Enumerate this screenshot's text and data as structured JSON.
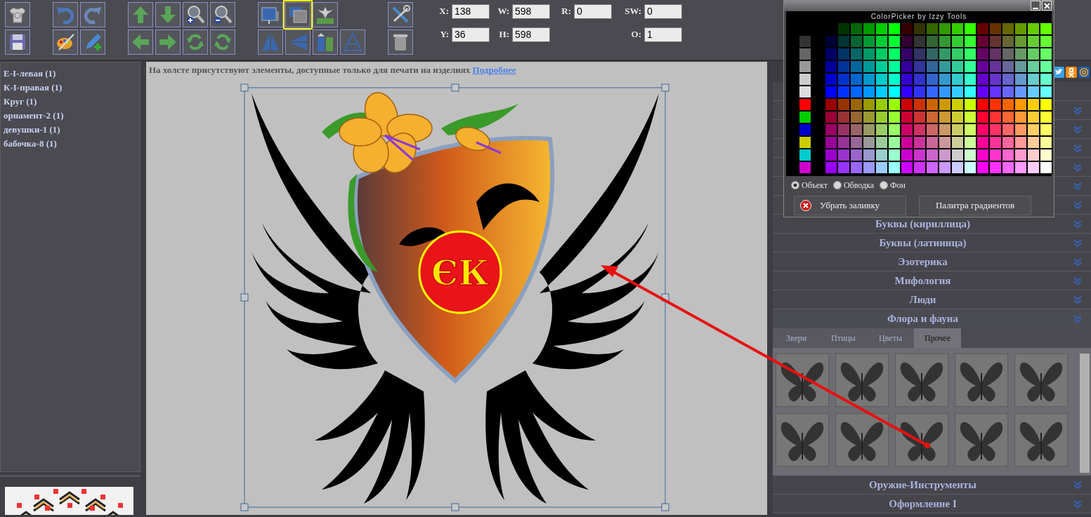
{
  "toolbar": {
    "groups": [
      {
        "rows": [
          [
            {
              "selected": false
            }
          ],
          [
            {
              "selected": false
            }
          ]
        ]
      },
      {
        "rows": [
          [
            {
              "selected": false
            },
            {
              "selected": false
            }
          ],
          [
            {
              "selected": false
            },
            {
              "selected": false
            }
          ]
        ]
      },
      {
        "rows": [
          [
            {
              "selected": false
            },
            {
              "selected": false
            },
            {
              "selected": false
            },
            {
              "selected": false
            }
          ],
          [
            {
              "selected": false
            },
            {
              "selected": false
            },
            {
              "selected": false
            },
            {
              "selected": false
            }
          ]
        ]
      },
      {
        "rows": [
          [
            {
              "selected": false
            },
            {
              "selected": true
            },
            {
              "selected": false
            }
          ],
          [
            {
              "selected": false
            },
            {
              "selected": false
            },
            {
              "selected": false
            },
            {
              "selected": false
            }
          ]
        ]
      },
      {
        "rows": [
          [
            {
              "selected": false
            }
          ],
          [
            {
              "selected": false
            }
          ]
        ]
      }
    ]
  },
  "properties": [
    [
      {
        "label": "X:",
        "value": "138"
      },
      {
        "label": "W:",
        "value": "598"
      },
      {
        "label": "R:",
        "value": "0"
      },
      {
        "label": "SW:",
        "value": "0"
      }
    ],
    [
      {
        "label": "Y:",
        "value": "36"
      },
      {
        "label": "H:",
        "value": "598"
      },
      {
        "label": "O:",
        "value": "1"
      }
    ]
  ],
  "layers": [
    "Е-І-левая (1)",
    "К-І-правая (1)",
    "Круг (1)",
    "орнамент-2 (1)",
    "девушки-1 (1)",
    "бабочка-8 (1)"
  ],
  "canvas": {
    "notice": "На холсте присутствуют элементы, доступные только для печати на изделиях",
    "notice_link": "Подробнее",
    "monogram": "ЄК"
  },
  "color_picker": {
    "title": "ColorPicker by Izzy Tools",
    "targets": [
      {
        "label": "Объект",
        "selected": true
      },
      {
        "label": "Обводка",
        "selected": false
      },
      {
        "label": "Фон",
        "selected": false
      }
    ],
    "buttons": [
      {
        "label": "Убрать заливку",
        "kind": "clear"
      },
      {
        "label": "Палитра градиентов",
        "kind": "plain"
      }
    ]
  },
  "categories": [
    {
      "title": "Буквы (кириллица)",
      "expanded": false
    },
    {
      "title": "Буквы (латиница)",
      "expanded": false
    },
    {
      "title": "Эзотерика",
      "expanded": false
    },
    {
      "title": "Мифология",
      "expanded": false
    },
    {
      "title": "Люди",
      "expanded": false
    },
    {
      "title": "Флора и фауна",
      "expanded": true,
      "tabs": [
        {
          "label": "Звери",
          "selected": false
        },
        {
          "label": "Птицы",
          "selected": false
        },
        {
          "label": "Цветы",
          "selected": false
        },
        {
          "label": "Прочее",
          "selected": true
        }
      ]
    },
    {
      "title": "Оружие-Инструменты",
      "expanded": false
    },
    {
      "title": "Оформление I",
      "expanded": false
    }
  ]
}
